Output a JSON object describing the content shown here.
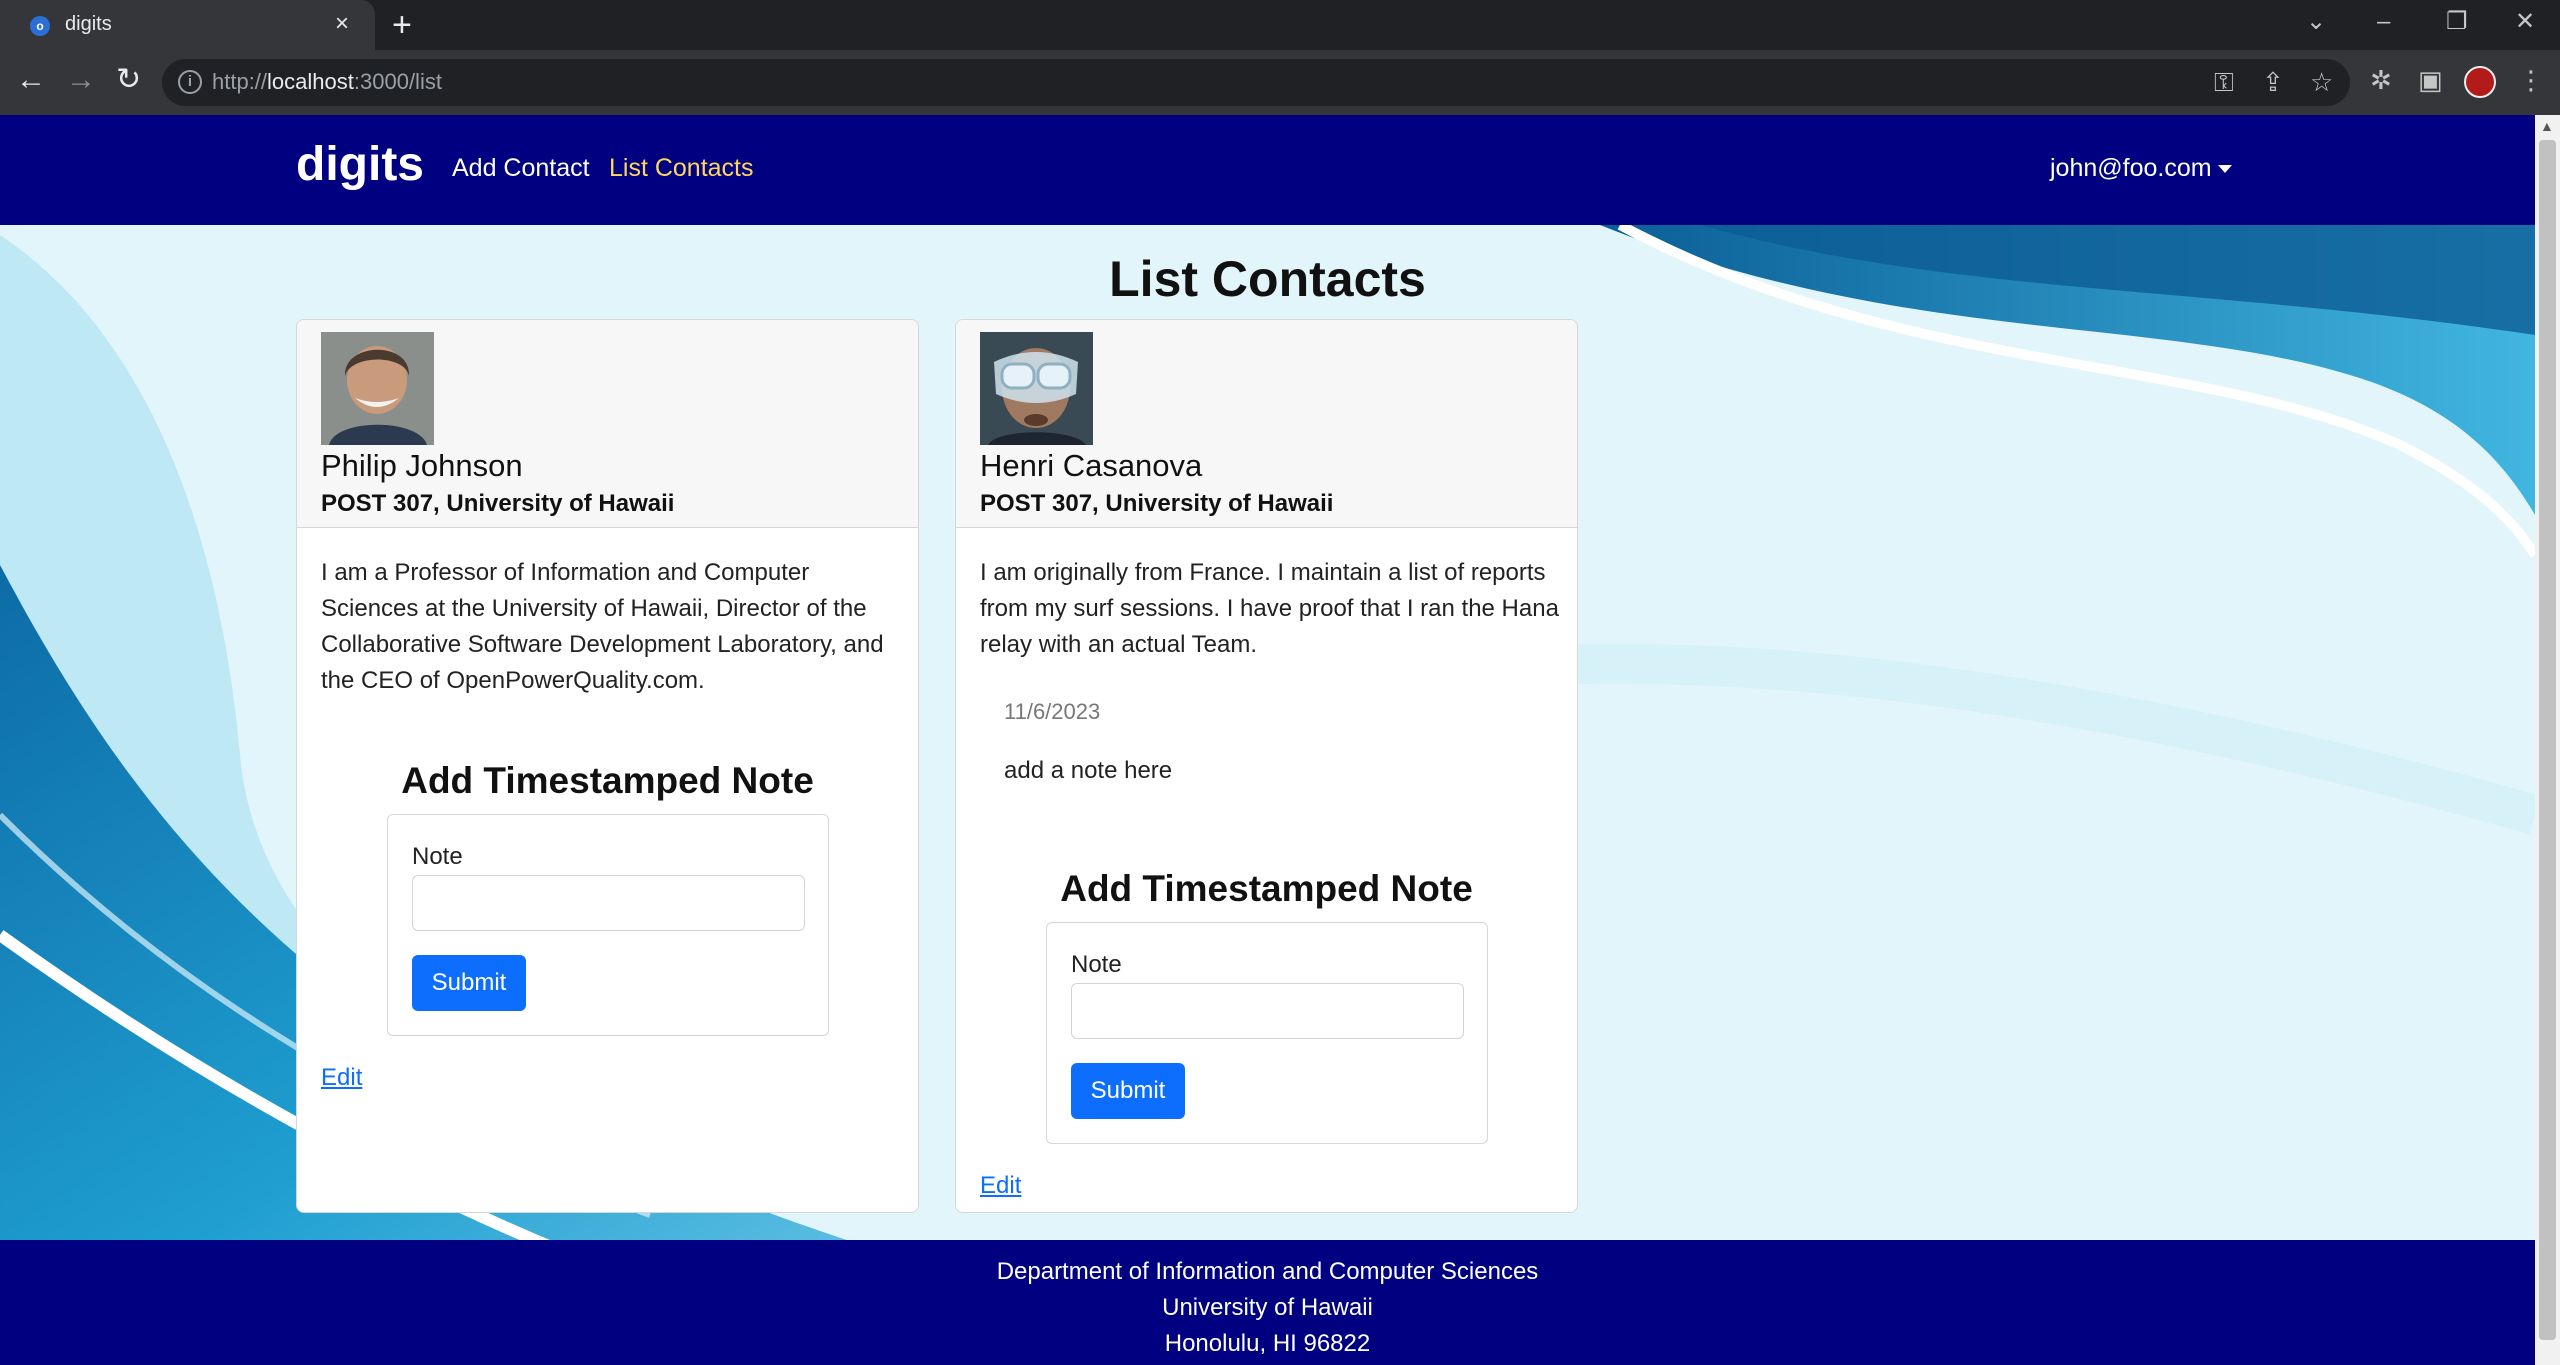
{
  "browser": {
    "tab_title": "digits",
    "url_host": "localhost",
    "url_prefix": "http://",
    "url_rest": ":3000/list",
    "tab_close": "×",
    "new_tab": "+"
  },
  "navbar": {
    "brand": "digits",
    "links": [
      {
        "label": "Add Contact"
      },
      {
        "label": "List Contacts"
      }
    ],
    "user": "john@foo.com"
  },
  "page": {
    "title": "List Contacts"
  },
  "contacts": [
    {
      "name": "Philip Johnson",
      "address": "POST 307, University of Hawaii",
      "description": "I am a Professor of Information and Computer Sciences at the University of Hawaii, Director of the Collaborative Software Development Laboratory, and the CEO of OpenPowerQuality.com.",
      "form_title": "Add Timestamped Note",
      "note_label": "Note",
      "submit_label": "Submit",
      "edit_label": "Edit"
    },
    {
      "name": "Henri Casanova",
      "address": "POST 307, University of Hawaii",
      "description": "I am originally from France. I maintain a list of reports from my surf sessions. I have proof that I ran the Hana relay with an actual Team.",
      "notes": [
        {
          "date": "11/6/2023",
          "text": "add a note here"
        }
      ],
      "form_title": "Add Timestamped Note",
      "note_label": "Note",
      "submit_label": "Submit",
      "edit_label": "Edit"
    }
  ],
  "footer": {
    "line1": "Department of Information and Computer Sciences",
    "line2": "University of Hawaii",
    "line3": "Honolulu, HI 96822"
  },
  "colors": {
    "navbar": "#000080",
    "active_link": "#ffd75e",
    "button": "#0d6efd"
  }
}
